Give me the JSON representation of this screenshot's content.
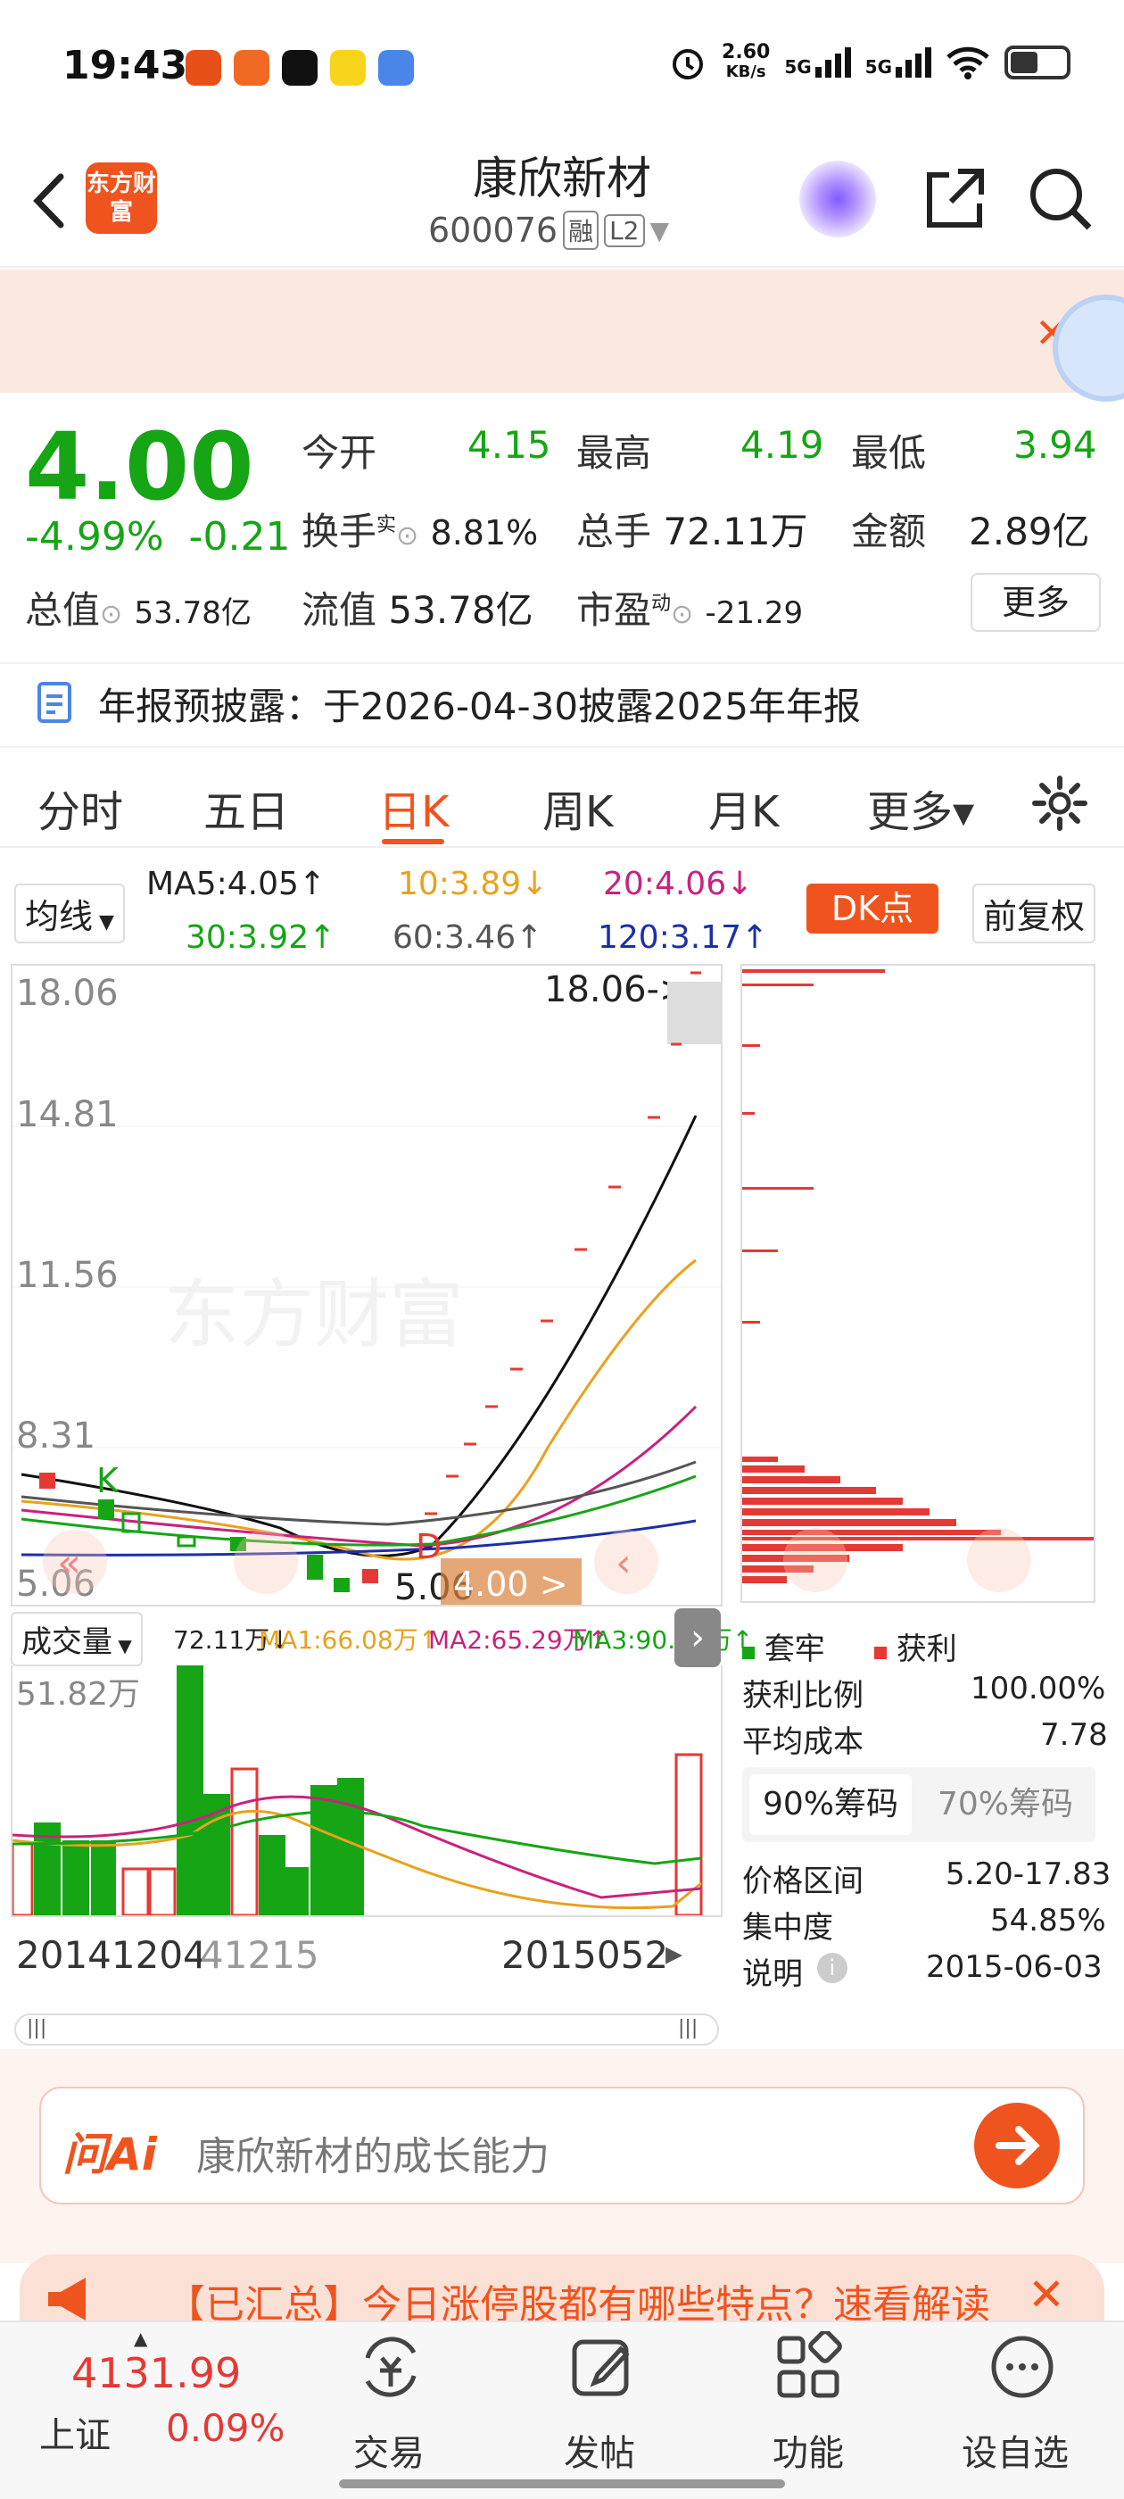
{
  "status": {
    "time": "19:43",
    "net_speed": "2.60",
    "net_unit": "KB/s",
    "sig1": "5G",
    "sig2": "5G"
  },
  "header": {
    "logo": "东方财富",
    "name": "康欣新材",
    "code": "600076",
    "tag1": "融",
    "tag2": "L2"
  },
  "quote": {
    "price": "4.00",
    "chg_pct": "-4.99%",
    "chg": "-0.21",
    "open_label": "今开",
    "open": "4.15",
    "high_label": "最高",
    "high": "4.19",
    "low_label": "最低",
    "low": "3.94",
    "turnover_label": "换手",
    "turnover_sup": "实",
    "turnover": "8.81%",
    "vol_label": "总手",
    "vol": "72.11万",
    "amount_label": "金额",
    "amount": "2.89亿",
    "mcap_label": "总值",
    "mcap": "53.78亿",
    "float_label": "流值",
    "float": "53.78亿",
    "pe_label": "市盈",
    "pe_sup": "动",
    "pe": "-21.29",
    "more": "更多"
  },
  "notice": "年报预披露：于2026-04-30披露2025年年报",
  "tabs": [
    "分时",
    "五日",
    "日K",
    "周K",
    "月K",
    "更多▾"
  ],
  "ma": {
    "sel": "均线",
    "ma5": "MA5:4.05↑",
    "ma10": "10:3.89↓",
    "ma20": "20:4.06↓",
    "ma30": "30:3.92↑",
    "ma60": "60:3.46↑",
    "ma120": "120:3.17↑",
    "dk": "DK点",
    "fq": "前复权"
  },
  "chart": {
    "yticks": [
      "18.06",
      "14.81",
      "11.56",
      "8.31",
      "5.06"
    ],
    "max_label": "18.06->",
    "min_label": "5.06",
    "price_tag": "4.00 >",
    "watermark": "东方财富",
    "k_mark": "K",
    "d_mark": "D"
  },
  "volume": {
    "sel": "成交量",
    "v": "72.11万↓",
    "ma1": "MA1:66.08万↑",
    "ma2": "MA2:65.29万↑",
    "ma3": "MA3:90.05万↑",
    "top": "51.82万"
  },
  "dates": {
    "d1": "20141204",
    "d2": "41215",
    "d3": "2015052"
  },
  "chips": {
    "legend_trap": "套牢",
    "legend_profit": "获利",
    "profit_ratio_label": "获利比例",
    "profit_ratio": "100.00%",
    "avg_cost_label": "平均成本",
    "avg_cost": "7.78",
    "tab90": "90%筹码",
    "tab70": "70%筹码",
    "range_label": "价格区间",
    "range": "5.20-17.83",
    "conc_label": "集中度",
    "conc": "54.85%",
    "desc_label": "说明",
    "desc": "2015-06-03"
  },
  "ai": {
    "brand": "问Ai",
    "placeholder": "康欣新材的成长能力"
  },
  "marquee": "【已汇总】今日涨停股都有哪些特点？速看解读",
  "bottom": {
    "index_val": "4131.99",
    "index_name": "上证",
    "index_chg": "0.09%",
    "trade": "交易",
    "post": "发帖",
    "func": "功能",
    "watch": "设自选"
  }
}
